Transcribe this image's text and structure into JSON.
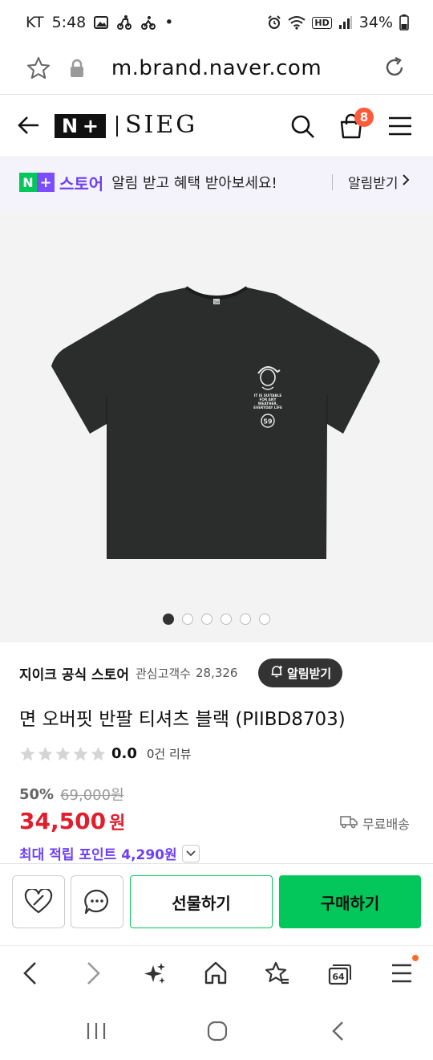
{
  "status_bar": {
    "carrier": "KT",
    "time": "5:48",
    "dot": "•",
    "network": "HD",
    "battery": "34%"
  },
  "browser": {
    "url": "m.brand.naver.com"
  },
  "header": {
    "logo_n": "N",
    "logo_plus": "+",
    "brand": "SIEG",
    "cart_count": "8"
  },
  "banner": {
    "logo_n": "N",
    "logo_plus": "+",
    "store_label": "스토어",
    "message": "알림 받고 혜택 받아보세요!",
    "cta": "알림받기"
  },
  "product": {
    "store_name": "지이크 공식 스토어",
    "follower_label": "관심고객수",
    "follower_count": "28,326",
    "notify_button": "알림받기",
    "title": "면 오버핏 반팔 티셔츠 블랙 (PIIBD8703)",
    "rating": "0.0",
    "review_count": "0건 리뷰",
    "discount_rate": "50%",
    "original_price": "69,000원",
    "sale_price": "34,500",
    "sale_unit": "원",
    "shipping": "무료배송",
    "points": "최대 적립 포인트 4,290원",
    "image_count": 6,
    "active_image": 1,
    "shirt_print_lines": [
      "IT IS SUITABLE",
      "FOR ANY",
      "WEATHER,",
      "EVERYDAY LIFE"
    ],
    "shirt_print_badge": "59",
    "shirt_tag": "59"
  },
  "actions": {
    "gift": "선물하기",
    "buy": "구매하기"
  },
  "browser_nav": {
    "tabs_count": "64"
  },
  "colors": {
    "naver_green": "#03c75a",
    "naver_purple": "#6d3ff5",
    "price_red": "#e01e2e",
    "badge_orange": "#ff5a3c"
  }
}
